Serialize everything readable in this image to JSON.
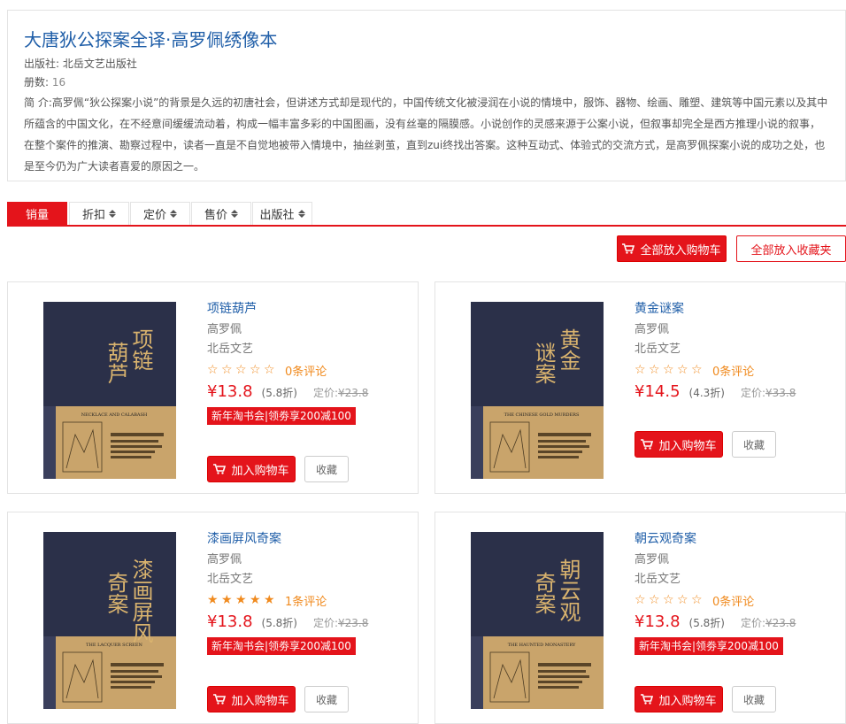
{
  "book": {
    "title": "大唐狄公探案全译·高罗佩绣像本",
    "publisher_label": "出版社:",
    "publisher": "北岳文艺出版社",
    "volumes_label": "册数:",
    "volumes": "16",
    "desc_label": "简  介:",
    "description": "高罗佩“狄公探案小说”的背景是久远的初唐社会，但讲述方式却是现代的，中国传统文化被浸润在小说的情境中，服饰、器物、绘画、雕塑、建筑等中国元素以及其中所蕴含的中国文化，在不经意间缓缓流动着，构成一幅丰富多彩的中国图画，没有丝毫的隔膜感。小说创作的灵感来源于公案小说，但叙事却完全是西方推理小说的叙事，在整个案件的推演、勘察过程中，读者一直是不自觉地被带入情境中，抽丝剥茧，直到zui终找出答案。这种互动式、体验式的交流方式，是高罗佩探案小说的成功之处，也是至今仍为广大读者喜爱的原因之一。"
  },
  "sort_tabs": [
    {
      "label": "销量",
      "active": true
    },
    {
      "label": "折扣",
      "active": false
    },
    {
      "label": "定价",
      "active": false
    },
    {
      "label": "售价",
      "active": false
    },
    {
      "label": "出版社",
      "active": false
    }
  ],
  "actions": {
    "cart_all": "全部放入购物车",
    "fav_all": "全部放入收藏夹"
  },
  "products": [
    {
      "name": "项链葫芦",
      "author": "高罗佩",
      "publisher": "北岳文艺",
      "rating": 0,
      "reviews": "0条评论",
      "price": "¥13.8",
      "discount": "(5.8折)",
      "orig_label": "定价:",
      "orig_price": "¥23.8",
      "promo": "新年淘书会|领劵享200减100",
      "cover_title_a": "项链",
      "cover_title_b": "葫芦",
      "cover_en": "NECKLACE AND CALABASH",
      "add_cart": "加入购物车",
      "favorite": "收藏"
    },
    {
      "name": "黄金谜案",
      "author": "高罗佩",
      "publisher": "北岳文艺",
      "rating": 0,
      "reviews": "0条评论",
      "price": "¥14.5",
      "discount": "(4.3折)",
      "orig_label": "定价:",
      "orig_price": "¥33.8",
      "promo": "",
      "cover_title_a": "黄金",
      "cover_title_b": "谜案",
      "cover_en": "THE CHINESE GOLD MURDERS",
      "add_cart": "加入购物车",
      "favorite": "收藏"
    },
    {
      "name": "漆画屏风奇案",
      "author": "高罗佩",
      "publisher": "北岳文艺",
      "rating": 5,
      "reviews": "1条评论",
      "price": "¥13.8",
      "discount": "(5.8折)",
      "orig_label": "定价:",
      "orig_price": "¥23.8",
      "promo": "新年淘书会|领劵享200减100",
      "cover_title_a": "漆画屏风",
      "cover_title_b": "奇案",
      "cover_en": "THE LACQUER SCREEN",
      "add_cart": "加入购物车",
      "favorite": "收藏"
    },
    {
      "name": "朝云观奇案",
      "author": "高罗佩",
      "publisher": "北岳文艺",
      "rating": 0,
      "reviews": "0条评论",
      "price": "¥13.8",
      "discount": "(5.8折)",
      "orig_label": "定价:",
      "orig_price": "¥23.8",
      "promo": "新年淘书会|领劵享200减100",
      "cover_title_a": "朝云观",
      "cover_title_b": "奇案",
      "cover_en": "THE HAUNTED MONASTERY",
      "add_cart": "加入购物车",
      "favorite": "收藏"
    }
  ],
  "colors": {
    "accent": "#e4141b",
    "link": "#1f5ea8",
    "star": "#f08a1e",
    "cover_dark": "#2b3049",
    "cover_tan": "#c9a46b"
  }
}
